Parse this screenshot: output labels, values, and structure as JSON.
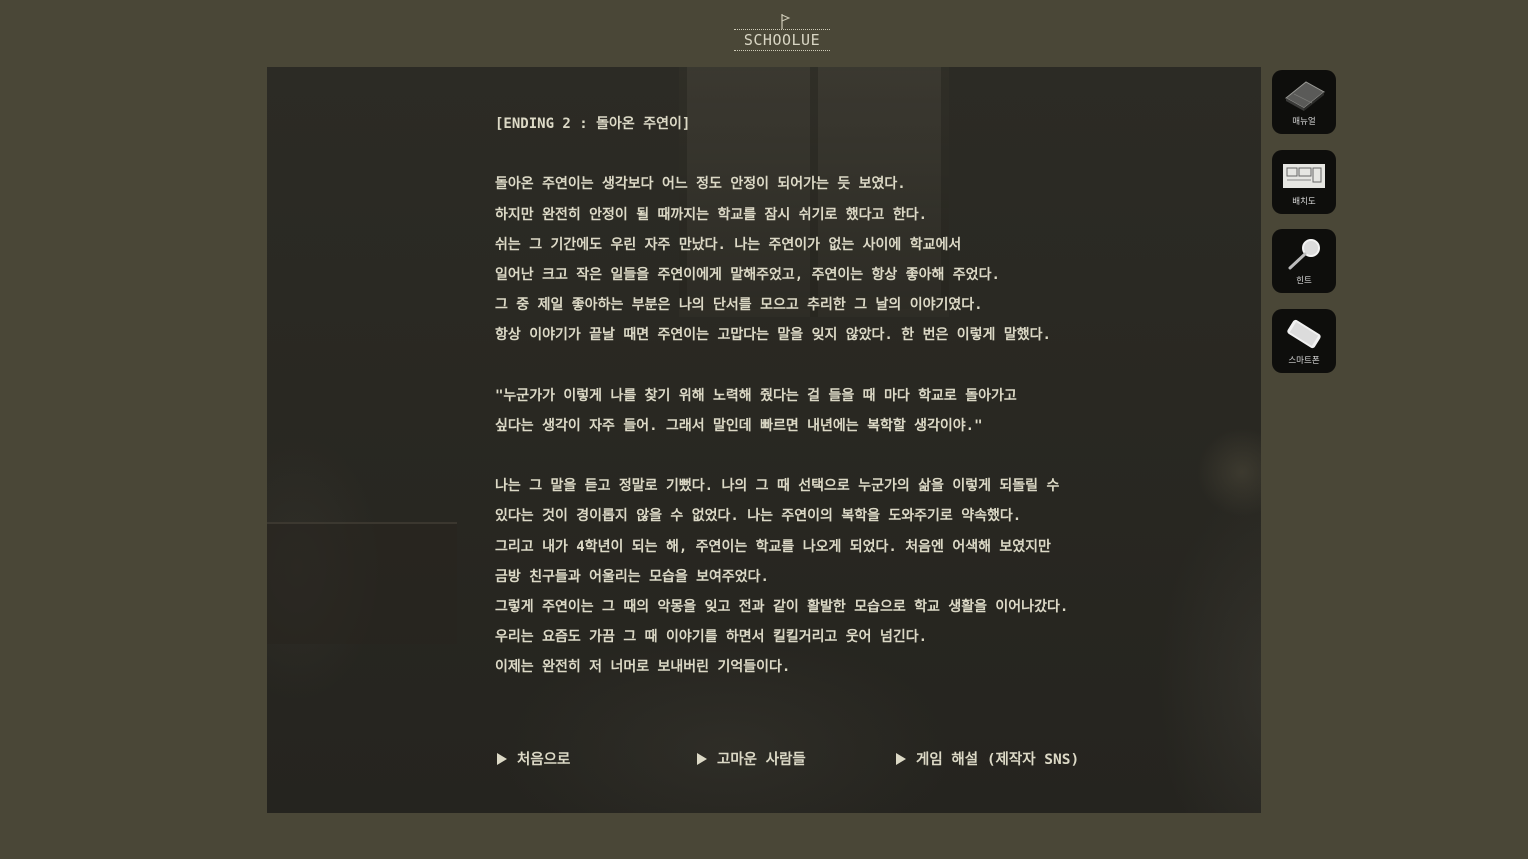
{
  "logo": {
    "text": "SCHOOLUE"
  },
  "story": {
    "title": "[ENDING 2 : 돌아온 주연이]",
    "lines": [
      "[ENDING 2 : 돌아온 주연이]",
      "",
      "돌아온 주연이는 생각보다 어느 정도 안정이 되어가는 듯 보였다.",
      "하지만 완전히 안정이 될 때까지는 학교를 잠시 쉬기로 했다고 한다.",
      "쉬는 그 기간에도 우린 자주 만났다. 나는 주연이가 없는 사이에 학교에서",
      "일어난 크고 작은 일들을 주연이에게 말해주었고, 주연이는 항상 좋아해 주었다.",
      "그 중 제일 좋아하는 부분은 나의 단서를 모으고 추리한 그 날의 이야기였다.",
      "항상 이야기가 끝날 때면 주연이는 고맙다는 말을 잊지 않았다. 한 번은 이렇게 말했다.",
      "",
      "\"누군가가 이렇게 나를 찾기 위해 노력해 줬다는 걸 들을 때 마다 학교로 돌아가고",
      "싶다는 생각이 자주 들어. 그래서 말인데 빠르면 내년에는 복학할 생각이야.\"",
      "",
      "나는 그 말을 듣고 정말로 기뻤다. 나의 그 때 선택으로 누군가의 삶을 이렇게 되돌릴 수",
      "있다는 것이 경이롭지 않을 수 없었다. 나는 주연이의 복학을 도와주기로 약속했다.",
      "그리고 내가 4학년이 되는 해, 주연이는 학교를 나오게 되었다. 처음엔 어색해 보였지만",
      "금방 친구들과 어울리는 모습을 보여주었다.",
      "그렇게 주연이는 그 때의 악몽을 잊고 전과 같이 활발한 모습으로 학교 생활을 이어나갔다.",
      "우리는 요즘도 가끔 그 때 이야기를 하면서 킬킬거리고 웃어 넘긴다.",
      "이제는 완전히 저 너머로 보내버린 기억들이다."
    ]
  },
  "menu": {
    "restart": "처음으로",
    "credits": "고마운 사람들",
    "commentary": "게임 해설 (제작자 SNS)"
  },
  "side": {
    "manual": "매뉴얼",
    "map": "배치도",
    "hint": "힌트",
    "phone": "스마트폰"
  },
  "icons": {
    "logo": "flag-icon",
    "manual": "notebook-icon",
    "map": "floor-map-icon",
    "hint": "magnifier-icon",
    "phone": "smartphone-icon",
    "menu": "play-arrow-icon"
  },
  "colors": {
    "background": "#4a4737",
    "stage": "#2a2924",
    "text": "#dcd9c6",
    "side_button": "#0e0e0c"
  }
}
